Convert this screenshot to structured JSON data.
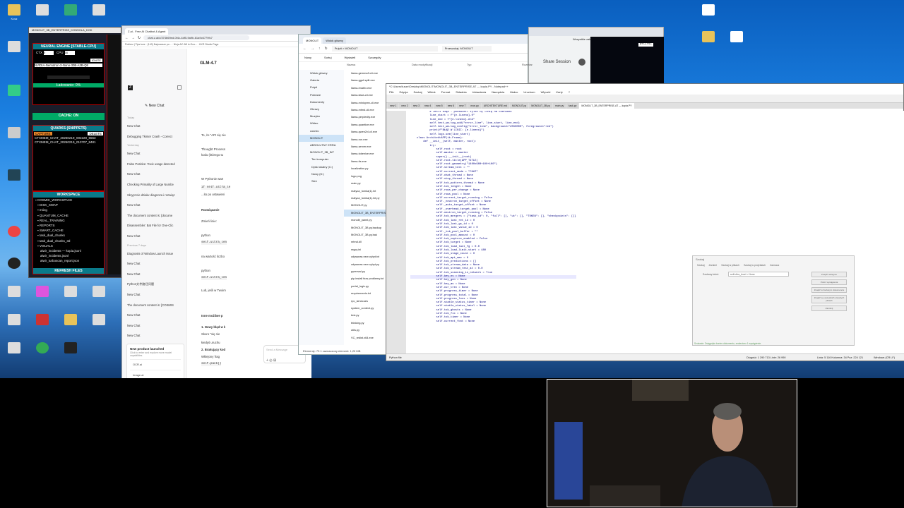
{
  "desktop": {
    "icons_left": [
      "Kosz",
      "",
      "",
      "",
      "",
      "",
      "",
      "",
      "",
      "",
      "",
      "",
      "",
      "",
      "",
      "",
      "",
      "",
      ""
    ],
    "icons_right": [
      "",
      "",
      "",
      ""
    ]
  },
  "monolit": {
    "title": "MONOLIT_3B_ENTERPRISE_KONSOLA_KOK",
    "engine_head": "NEURAL ENGINE [STABLE-CPU]",
    "ctx_label": "CTX",
    "ctx_val": "0",
    "cpu_label": "CPU",
    "cpu_val": "16",
    "ignite": "IGNITE",
    "model": "NVIDIA-Nemotron-3-Nano-30B-A3B-Q8",
    "loading": "Ładowanie: 0%",
    "cache": "CACHE: ON",
    "quarks_head": "QUARKS (SNIPPETS)",
    "capture": "CAPTURE",
    "delete": "DELETE",
    "q1": "CTXMEM_CHAT_20260219_002220_5563",
    "q2": "CTXMEM_CHAT_20260219_013707_8481",
    "ws_head": "WORKSPACE",
    "ws_items": [
      "COSMIC_WORKSPACE",
      "DISK_SWAP",
      "mózg",
      "QUANTUM_CACHE",
      "REAL_TRAINING",
      "REPORTS",
      "SMART_CACHE",
      "task_dual_chunks",
      "task_dual_chunks_3d",
      "VISUALS",
      "aiwir_incidents — kopia.jsonl",
      "aiwir_incidents.jsonl",
      "aiwir_turboscan_report.json"
    ],
    "refresh": "REFRESH FILES",
    "wyczysc": "WYCZYŚĆ"
  },
  "chat": {
    "tab1": "Z.ai - Free AI Chatbot & Agent",
    "url": "chat.z.ai/c/374b69ed-0f4c-4df5-9a9b-61a9c6779fc7",
    "bookmarks": "Pobierz | Tips.love · (140) Najnowsze po... · Ninja AC AB in Gno... · KKR Studio Page",
    "model": "GLM-4.7",
    "new_chat": "New Chat",
    "today": "Today",
    "yesterday": "Yesterday",
    "previous": "Previous 7 days",
    "history": [
      "New Chat",
      "Debugging Tkinter Crash - Correct",
      "New Chat",
      "False Positive: Toxic usage detected",
      "New Chat",
      "Checking Primality of Large Numbe",
      "Skrypt nie działa: diagnoza i rozwiąz",
      "New Chat",
      "The document content is: [docume",
      "Disassembler: Bat File for One-Clic",
      "New Chat",
      "Diagnosis of Window Launch Issue",
      "New Chat",
      "New Chat",
      "Python文件路径问题",
      "New Chat",
      "The document content is: [COSMIS",
      "New Chat",
      "New Chat",
      "New Chat"
    ],
    "promo_title": "New product launched",
    "promo_sub": "Click to enter and explore more model capabilities",
    "promo_items": [
      "OCR.ai",
      "Image.ai",
      "Audio.ai"
    ],
    "thought": "Thought Process",
    "lines": [
      "To, że \"API się nie",
      "kodu (którego tu",
      "W Pythonie wart",
      "if self.ultra_le",
      "...ito po ustawieni",
      "Rozwiązanie",
      "Zmień linie:",
      "python",
      "self.ultra_len",
      "na wartość liczbo",
      "python",
      "self.ultra_len",
      "Lub, jeśli w Twoim",
      "Inne możliwe p",
      "1. Nowy błąd w k",
      "Skoro \"się nie",
      "kiedyś uruchu",
      "2. Brakujący kod",
      "Wklejony frag",
      "self.pack()",
      "Send a Message"
    ]
  },
  "explorer": {
    "title": "MONOLIT",
    "tab2": "Widok główny",
    "path": "Pulpit  >  MONOLIT",
    "search": "Przeszukaj: MONOLIT",
    "toolbar": [
      "Nowy",
      "Sortuj",
      "Wyświetl",
      "Szczegóły"
    ],
    "cols": [
      "Nazwa",
      "Data modyfikacji",
      "Typ",
      "Rozmiar"
    ],
    "side": [
      "Widok główny",
      "Galeria",
      "Pulpit",
      "Pobrane",
      "Dokumenty",
      "Obrazy",
      "Muzyka",
      "Wideo",
      "cosmic",
      "MONOLIT",
      "ABSOLUTNY ERRA",
      "MONOLIT_3B_INT",
      "Ten komputer",
      "Dysk lokalny (C:)",
      "Nowy (D:)",
      "Sieć"
    ],
    "files": [
      "llama-gemma3-cli.exe",
      "llama-gguf-split.exe",
      "llama-imatrix.exe",
      "llama-llava-cli.exe",
      "llama-minicpmv-cli.exe",
      "llama-mtmd-cli.exe",
      "llama-perplexity.exe",
      "llama-quantize.exe",
      "llama-qwen2vl-cli.exe",
      "llama-run.exe",
      "llama-server.exe",
      "llama-tokenize.exe",
      "llama-tts.exe",
      "localization.py",
      "logo.png",
      "main.py",
      "matyca_tomka(1).txt",
      "matyca_tomka(1).txt.py",
      "MONOLIT.py",
      "MONOLIT_3B_ENTERPRISE",
      "monolit_panel.py",
      "MONOLIT_3B.py.backup",
      "MONOLIT_3B.py.bak",
      "mtmd.dll",
      "mypy.ini",
      "odysseas new cyhyt.txt",
      "odysseas new cyhyt.py",
      "pyreeval.py",
      "pip install fsxs problemy.txt",
      "portal_logic.py",
      "requirements.txt",
      "rpc_simecues",
      "system_context.py",
      "test.py",
      "thinking.py",
      "utils.py",
      "VC_redist.x64.exe"
    ],
    "status": "Elementy: 73    1 zaznaczony element: 1,20 MB"
  },
  "npp": {
    "title": "*C:\\Users\\tusze\\Desktop\\MONOLIT\\MONOLIT_3B_ENTERPRISE-AT — kopia.PY - Notepad++",
    "menu": [
      "Plik",
      "Edycja",
      "Szukaj",
      "Widok",
      "Format",
      "Składnia",
      "Ustawienia",
      "Narzędzia",
      "Makro",
      "Uruchom",
      "Wtyczki",
      "Karty",
      "?"
    ],
    "tabs": [
      "new 1",
      "new 2",
      "new 3",
      "new 4",
      "new 5",
      "new 6",
      "new 7",
      "mon.py",
      "ARCHITEKTURE.md",
      "MONOLIT.py",
      "MONOLIT_3B.py",
      "main.py",
      "task.py",
      "MONOLIT_3B_ENTERPRISE-AT — kopia.PY"
    ],
    "code": [
      "            # Jeśli błąd - podświetl tylko tę linię na czerwono",
      "            line_start = f\"{e.lineno}.0\"",
      "            line_end = f\"{e.lineno}.end\"",
      "",
      "            self.text_wa.tag_add(\"error_line\", line_start, line_end)",
      "            self.text_wa.tag_config(\"error_line\", background=\"#550000\", foreground=\"red\")",
      "",
      "            print(f\"BŁĄD W LINII: {e.lineno}\")",
      "            self.logs.see(line_start)",
      "",
      "    class ArchitektAPP(tk.Frame):",
      "        def __init__(self, master, root):",
      "            try:",
      "                self.root = root",
      "                self.master = master",
      "                super().__init__(root)",
      "                self.root.title(APP_TITLE)",
      "                self.root.geometry(\"1400x900+100+100\")",
      "",
      "                self.stream_text = \"\"",
      "                self.current_mode = \"CHAT\"",
      "                self.chat_thread = None",
      "                self.stop_thread = None",
      "                self.tok_pattern_thread = None",
      "                self.tok_length = None",
      "                self.rows_per_change = None",
      "                self.rows_pool = None",
      "                self.current_target_running = False",
      "                self._neutron_target_offset = None",
      "                self._auto_target_offset = None",
      "                self._overhead_target_pool = None",
      "                self.neutron_target_running = False",
      "                self.tok_mergers = {\"task_id\": 0, \"full\": [], \"ut\": [], \"TOKEN\": [], \"checkpoints\": []}",
      "                self.tok_last_ret_id = 0",
      "                self.tok_last_gs_id = 0",
      "                self.tok_last_value_id = 0",
      "                self._tok_pool_buffer = \"\"",
      "                self.tok_pool_amount = 0",
      "                self.tok_capture_enabled = False",
      "                self.tok_target = None",
      "                self.tok_load_last_fg = 0.0",
      "                self.tok_load_limit_start = 480",
      "                self.tok_stage_count = 0",
      "                self.tok_mpt_max = 8",
      "                self.tok_predictions = []",
      "                self.tok_stream_data = None",
      "                self.tok_stream_rest_at = 0.0",
      "                self.tok_scanning_in_network = True",
      "                self.key_ns = None",
      "                self.key_gen = None",
      "                self.key_ms = None",
      "                self.cur_trex = None",
      "                self.progress_timer = None",
      "                self.progress_total = None",
      "                self.progress_loss = None",
      "                self.stable_status_timer = None",
      "                self.stable_status_label = None",
      "                self.tok_ghosts = None",
      "                self.tok_fix = None",
      "",
      "                self.tok_timer = None",
      "                self.current_font = None"
    ],
    "status_left": "Python file",
    "status_mid": "Długość: 1 290 713   Linie: 26 990",
    "status_pos": "Linia: 5 116   Kolumna: 34   Poz: 224 121",
    "status_enc": "Windows (CR LF)"
  },
  "dialog": {
    "title": "Szukaj",
    "tabs": [
      "Szukaj",
      "Zamień",
      "Szukaj w plikach",
      "Szukaj w projektach",
      "Zaznacz"
    ],
    "label": "Szukany tekst:",
    "value": "self.ultra_level = None",
    "btns": [
      "Znajdź następne",
      "Policz wystąpienia",
      "Znajdź w bieżącym dokumencie",
      "Znajdź we wszystkich otwartych plikach",
      "Zamknij"
    ],
    "status": "Szukanie: Osiągnięto koniec dokumentu, znaleziono 1 wystąpienie."
  },
  "chrome_right": {
    "share": "Share Session",
    "bookmarks_all": "Wszystkie zakładki"
  }
}
